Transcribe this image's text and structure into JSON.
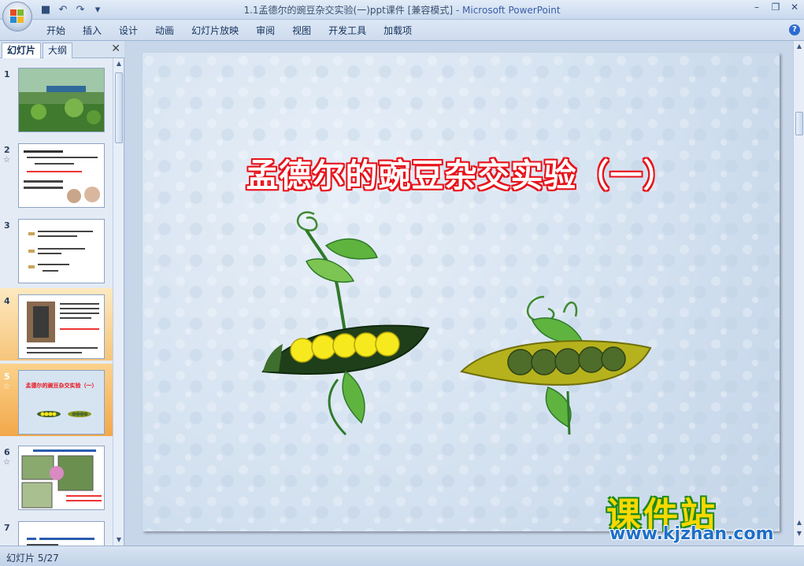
{
  "window": {
    "title": "1.1孟德尔的豌豆杂交实验(一)ppt课件 [兼容模式]",
    "app_name": "- Microsoft PowerPoint"
  },
  "ribbon": {
    "tabs": [
      "开始",
      "插入",
      "设计",
      "动画",
      "幻灯片放映",
      "审阅",
      "视图",
      "开发工具",
      "加载项"
    ]
  },
  "pane": {
    "tab_slides": "幻灯片",
    "tab_outline": "大纲",
    "thumbnails": [
      {
        "num": "1",
        "anim": ""
      },
      {
        "num": "2",
        "anim": "☆"
      },
      {
        "num": "3",
        "anim": ""
      },
      {
        "num": "4",
        "anim": ""
      },
      {
        "num": "5",
        "anim": "☆"
      },
      {
        "num": "6",
        "anim": "☆"
      },
      {
        "num": "7",
        "anim": ""
      }
    ],
    "thumb5_title": "孟德尔的豌豆杂交实验（一）"
  },
  "slide": {
    "title": "孟德尔的豌豆杂交实验（一）"
  },
  "watermark": {
    "brand": "课件站",
    "url": "www.kjzhan.com"
  },
  "status": {
    "slide_counter": "幻灯片 5/27"
  },
  "colors": {
    "title_outline": "#e8121b",
    "selection": "#f2a84a",
    "ribbon": "#cfdcee"
  }
}
